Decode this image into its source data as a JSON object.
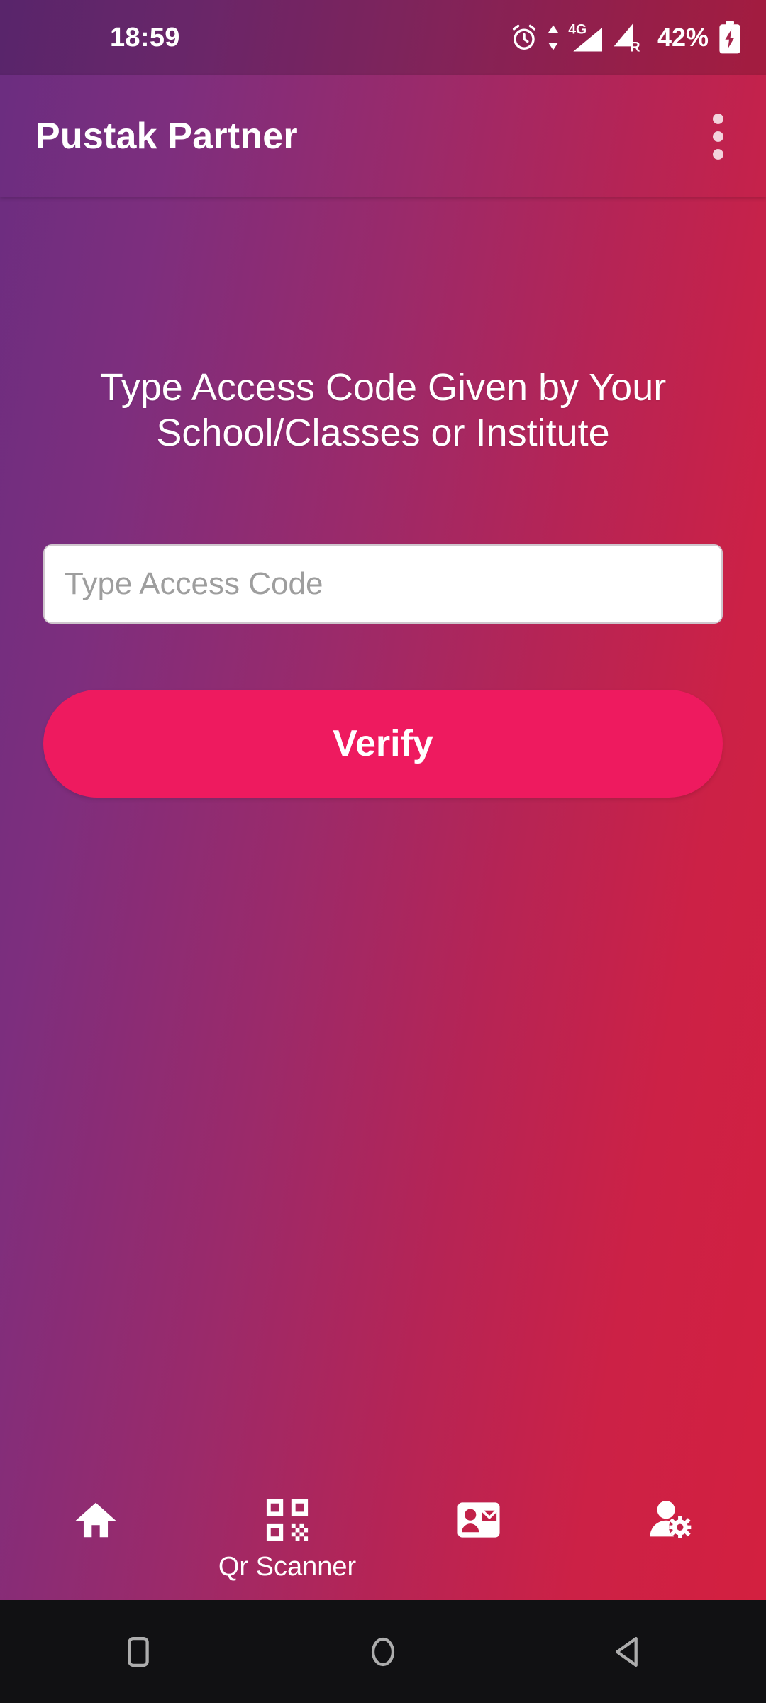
{
  "status_bar": {
    "clock": "18:59",
    "battery_percent": "42%",
    "network_type": "4G",
    "roaming_label": "R",
    "icons": [
      "alarm-icon",
      "data-transfer-icon",
      "signal-4g-icon",
      "signal-roaming-icon",
      "battery-charging-icon"
    ]
  },
  "app_bar": {
    "title": "Pustak Partner",
    "overflow_icon": "overflow-menu-icon"
  },
  "main": {
    "heading": "Type Access Code Given by Your School/Classes or Institute",
    "access_code": {
      "value": "",
      "placeholder": "Type Access Code"
    },
    "verify_label": "Verify"
  },
  "bottom_nav": {
    "items": [
      {
        "label": "",
        "icon": "home-icon",
        "active": false
      },
      {
        "label": "Qr Scanner",
        "icon": "qr-code-icon",
        "active": true
      },
      {
        "label": "",
        "icon": "contact-card-icon",
        "active": false
      },
      {
        "label": "",
        "icon": "user-settings-icon",
        "active": false
      }
    ]
  },
  "android_nav": {
    "recents_label": "recents-icon",
    "home_label": "home-circle-icon",
    "back_label": "back-triangle-icon"
  },
  "colors": {
    "gradient_start": "#6A2D80",
    "gradient_end": "#D4203F",
    "accent_button": "#EE1A5F",
    "text_on_dark": "#FFFFFF",
    "placeholder": "#9E9E9E",
    "android_nav_bg": "#111113"
  }
}
